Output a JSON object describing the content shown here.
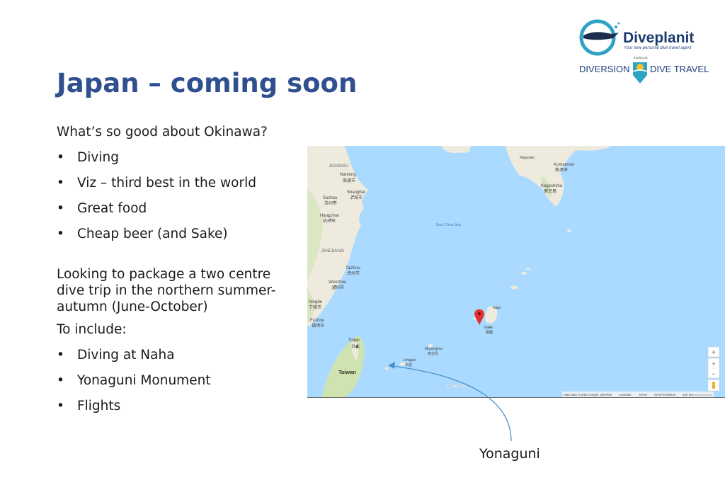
{
  "slide": {
    "title": "Japan – coming soon",
    "intro": "What’s so good about Okinawa?",
    "bullets1": [
      "Diving",
      "Viz – third best in the world",
      "Great food",
      "Cheap beer (and Sake)"
    ],
    "para": "Looking to package a two centre dive trip in the northern summer-autumn (June-October)",
    "include_label": "To include:",
    "bullets2": [
      "Diving at Naha",
      "Yonaguni Monument",
      "Flights"
    ],
    "callout": "Yonaguni"
  },
  "logo": {
    "brand": "Diveplanit",
    "tagline": "Your new personal dive travel agent",
    "trading_as": "trading as",
    "partner_left": "DIVERSION",
    "partner_right": "DIVE TRAVEL"
  },
  "map": {
    "places": {
      "jiangsu": "JIANGSU",
      "nantong": "Nantong",
      "nantong_cn": "南通市",
      "shanghai": "Shanghai",
      "shanghai_cn": "上海市",
      "suzhou": "Suzhou",
      "suzhou_cn": "苏州市",
      "hangzhou": "Hangzhou",
      "hangzhou_cn": "杭州市",
      "zhejiang": "ZHEJIANG",
      "taizhou": "Taizhou",
      "taizhou_cn": "台州市",
      "wenzhou": "Wenzhou",
      "wenzhou_cn": "温州市",
      "fuzhou": "Fuzhou",
      "fuzhou_cn": "福州市",
      "ningde": "Ningde",
      "ningde_cn": "宁德市",
      "taipei": "Taipei",
      "taipei_cn": "台北",
      "taiwan": "Taiwan",
      "ishigaki": "Ishigaki",
      "ishigaki_cn": "石垣",
      "miyakojima": "Miyakojima",
      "miyakojima_cn": "宮古島",
      "nago": "Nago",
      "naha": "Naha",
      "naha_cn": "那覇",
      "nagasaki": "Nagasaki",
      "kumamoto": "Kumamoto",
      "kumamoto_cn": "熊本市",
      "kagoshima": "Kagoshima",
      "kagoshima_cn": "鹿児島",
      "east_china_sea": "East China Sea"
    },
    "google": "Google",
    "footer": {
      "data": "Map data ©2018 Google, ZENRIN",
      "australia": "Australia",
      "terms": "Terms",
      "feedback": "Send feedback",
      "scale": "100 km"
    },
    "zoom_in": "+",
    "zoom_out": "−",
    "colors": {
      "water": "#aadaff",
      "land": "#eeeade",
      "land_green": "#cfe3b0",
      "pin": "#e0312f"
    }
  }
}
